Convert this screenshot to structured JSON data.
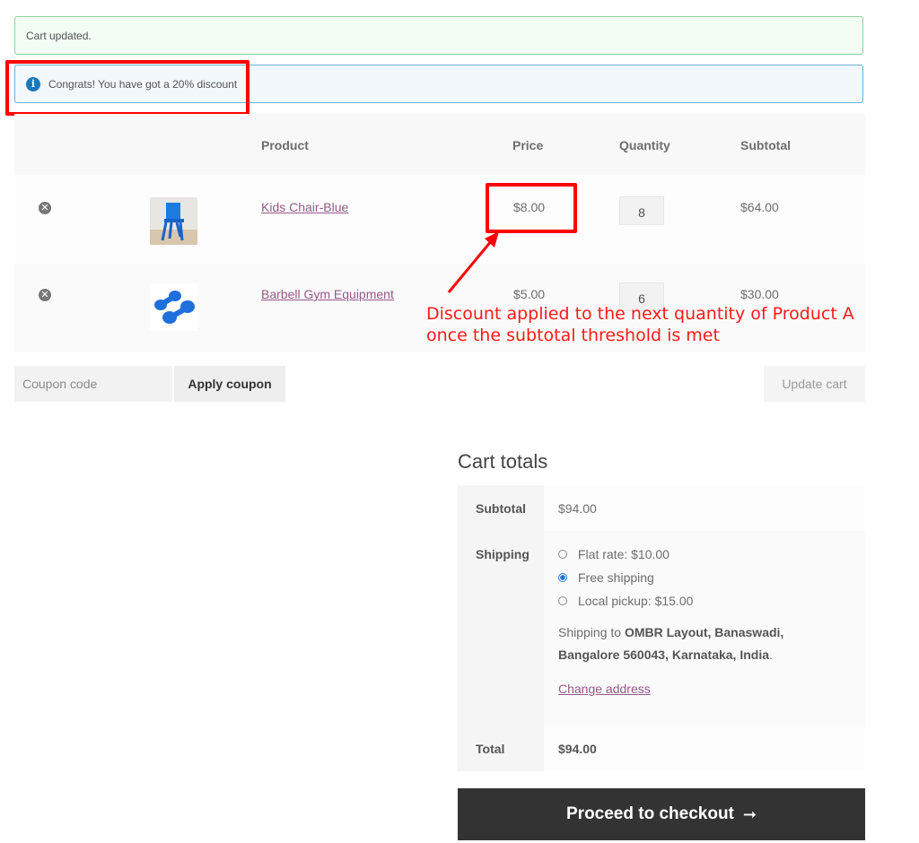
{
  "notices": {
    "success": "Cart updated.",
    "info": "Congrats! You have got a 20% discount",
    "info_icon": "info-icon"
  },
  "cart": {
    "headers": {
      "product": "Product",
      "price": "Price",
      "quantity": "Quantity",
      "subtotal": "Subtotal"
    },
    "items": [
      {
        "name": "Kids Chair-Blue",
        "price": "$8.00",
        "quantity": "8",
        "subtotal": "$64.00",
        "image": "blue-kids-chair"
      },
      {
        "name": "Barbell Gym Equipment",
        "price": "$5.00",
        "quantity": "6",
        "subtotal": "$30.00",
        "image": "blue-dumbbells"
      }
    ],
    "remove_symbol": "✕",
    "coupon_placeholder": "Coupon code",
    "apply_coupon": "Apply coupon",
    "update_cart": "Update cart"
  },
  "annotation": {
    "text_line1": "Discount applied to the next quantity of Product A",
    "text_line2": "once the subtotal threshold is met",
    "color": "#ff0000"
  },
  "totals": {
    "title": "Cart totals",
    "subtotal_label": "Subtotal",
    "subtotal_value": "$94.00",
    "shipping_label": "Shipping",
    "shipping_options": [
      {
        "label": "Flat rate: $10.00",
        "selected": false
      },
      {
        "label": "Free shipping",
        "selected": true
      },
      {
        "label": "Local pickup: $15.00",
        "selected": false
      }
    ],
    "shipping_to_prefix": "Shipping to ",
    "shipping_address": "OMBR Layout, Banaswadi, Bangalore 560043, Karnataka, India",
    "shipping_to_suffix": ".",
    "change_address": "Change address",
    "total_label": "Total",
    "total_value": "$94.00"
  },
  "checkout": {
    "label": "Proceed to checkout",
    "arrow": "➞"
  }
}
